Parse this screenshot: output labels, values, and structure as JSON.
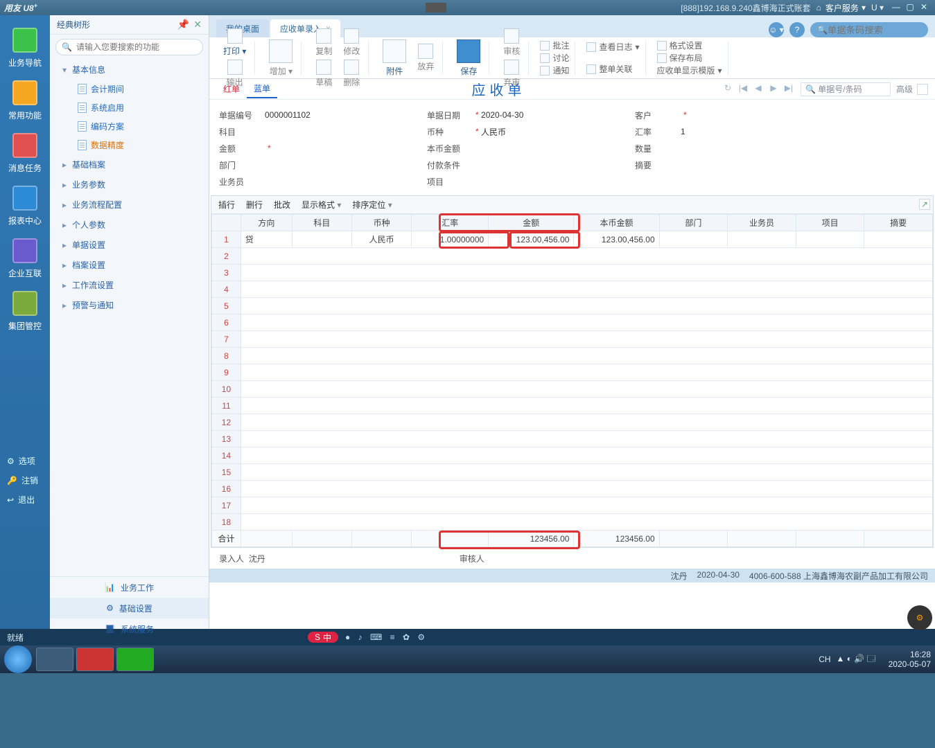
{
  "titlebar": {
    "logo": "用友 U8",
    "sup": "+",
    "account": "[888]192.168.9.240鑫博海正式账套",
    "service": "客户服务",
    "u": "U"
  },
  "leftnav": {
    "items": [
      "业务导航",
      "常用功能",
      "消息任务",
      "报表中心",
      "企业互联",
      "集团管控"
    ],
    "footer": {
      "opt": "选项",
      "reg": "注销",
      "exit": "退出"
    }
  },
  "tree": {
    "title": "经典树形",
    "placeholder": "请输入您要搜索的功能",
    "root": "基本信息",
    "leaves": [
      "会计期间",
      "系统启用",
      "编码方案",
      "数据精度"
    ],
    "nodes": [
      "基础档案",
      "业务参数",
      "业务流程配置",
      "个人参数",
      "单据设置",
      "档案设置",
      "工作流设置",
      "预警与通知"
    ],
    "foot": {
      "work": "业务工作",
      "base": "基础设置",
      "sys": "系统服务"
    }
  },
  "tabs": {
    "desktop": "我的桌面",
    "active": "应收单录入"
  },
  "search": {
    "placeholder": "单据条码搜索"
  },
  "ribbon": {
    "print": "打印",
    "export": "输出",
    "add": "增加",
    "copy": "复制",
    "draft": "草稿",
    "edit": "修改",
    "del": "删除",
    "attach": "附件",
    "abandon": "放弃",
    "save": "保存",
    "audit": "审核",
    "unaudit": "弃审",
    "approve": "批注",
    "discuss": "讨论",
    "notify": "通知",
    "log": "查看日志",
    "link": "整单关联",
    "format": "格式设置",
    "layout": "保存布局",
    "template": "应收单显示模版"
  },
  "bill": {
    "red": "红单",
    "blue": "蓝单",
    "title": "应收单",
    "nav": {
      "refresh": "↻",
      "first": "|◀",
      "prev": "◀",
      "next": "▶",
      "last": "▶|"
    },
    "code": "单据号/条码",
    "adv": "高级"
  },
  "form": {
    "no_l": "单据编号",
    "no": "0000001102",
    "date_l": "单据日期",
    "date": "2020-04-30",
    "cust_l": "客户",
    "subj_l": "科目",
    "curr_l": "币种",
    "curr": "人民币",
    "rate_l": "汇率",
    "rate": "1",
    "amt_l": "金额",
    "loc_l": "本币金额",
    "qty_l": "数量",
    "dept_l": "部门",
    "term_l": "付款条件",
    "digest_l": "摘要",
    "sales_l": "业务员",
    "proj_l": "项目"
  },
  "gridtb": {
    "ins": "插行",
    "del": "删行",
    "batch": "批改",
    "fmt": "显示格式",
    "sort": "排序定位"
  },
  "gridh": [
    "方向",
    "科目",
    "币种",
    "汇率",
    "金额",
    "本币金额",
    "部门",
    "业务员",
    "项目",
    "摘要"
  ],
  "gridrow": {
    "dir": "贷",
    "curr": "人民币",
    "rate": "1.00000000",
    "amt": "123.00,456.00",
    "loc": "123.00,456.00"
  },
  "sum": {
    "label": "合计",
    "amt": "123456.00",
    "loc": "123456.00"
  },
  "sign": {
    "entry_l": "录入人",
    "entry": "沈丹",
    "audit_l": "审核人"
  },
  "status": {
    "ready": "就绪",
    "user": "沈丹",
    "date": "2020-04-30",
    "tel": "4006-600-588 上海鑫博海农副产品加工有限公司"
  },
  "ime": {
    "label": "中",
    "icons": "●  ♪  ⌨  ≡  ✿  ⚙"
  },
  "taskbar": {
    "lang": "CH",
    "time": "16:28",
    "date2": "2020-05-07"
  }
}
